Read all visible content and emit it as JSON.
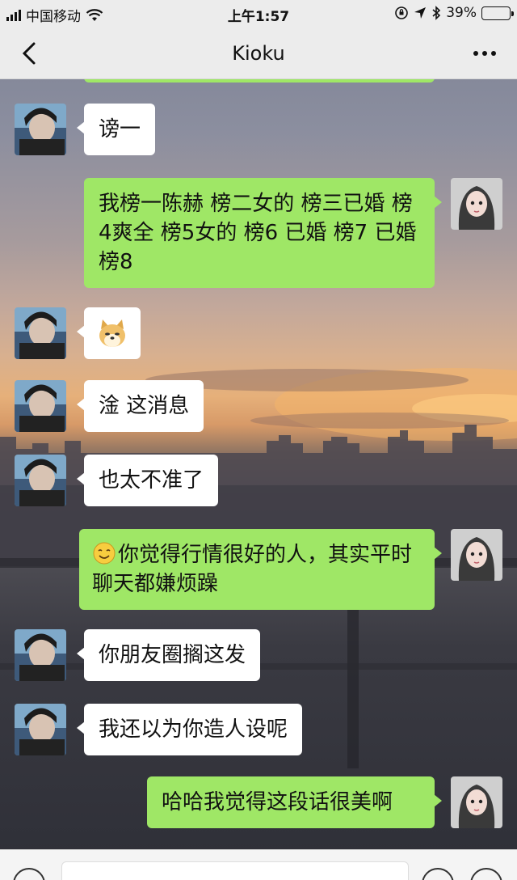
{
  "status_bar": {
    "carrier": "中国移动",
    "time": "上午1:57",
    "battery_percent_text": "39%",
    "battery_level": 0.39
  },
  "nav": {
    "title": "Kioku"
  },
  "messages": [
    {
      "side": "left",
      "text": "谤一"
    },
    {
      "side": "right",
      "text": "我榜一陈赫  榜二女的 榜三已婚 榜4爽全 榜5女的  榜6 已婚 榜7 已婚  榜8"
    },
    {
      "side": "left",
      "sticker": "doge"
    },
    {
      "side": "left",
      "text": "淦 这消息"
    },
    {
      "side": "left",
      "text": "也太不准了"
    },
    {
      "side": "right",
      "emoji": "smile",
      "text": "你觉得行情很好的人，其实平时聊天都嫌烦躁"
    },
    {
      "side": "left",
      "text": "你朋友圈搁这发"
    },
    {
      "side": "left",
      "text": "我还以为你造人设呢"
    },
    {
      "side": "right",
      "text": "哈哈我觉得这段话很美啊"
    }
  ],
  "colors": {
    "bubble_mine": "#9fe766",
    "bubble_other": "#ffffff",
    "bar_bg": "#ececec",
    "battery_fill": "#f2c12e"
  },
  "icons": {
    "back": "chevron-left-icon",
    "more": "more-dots-icon",
    "voice": "voice-icon",
    "emoji": "emoji-icon",
    "plus": "plus-icon"
  }
}
